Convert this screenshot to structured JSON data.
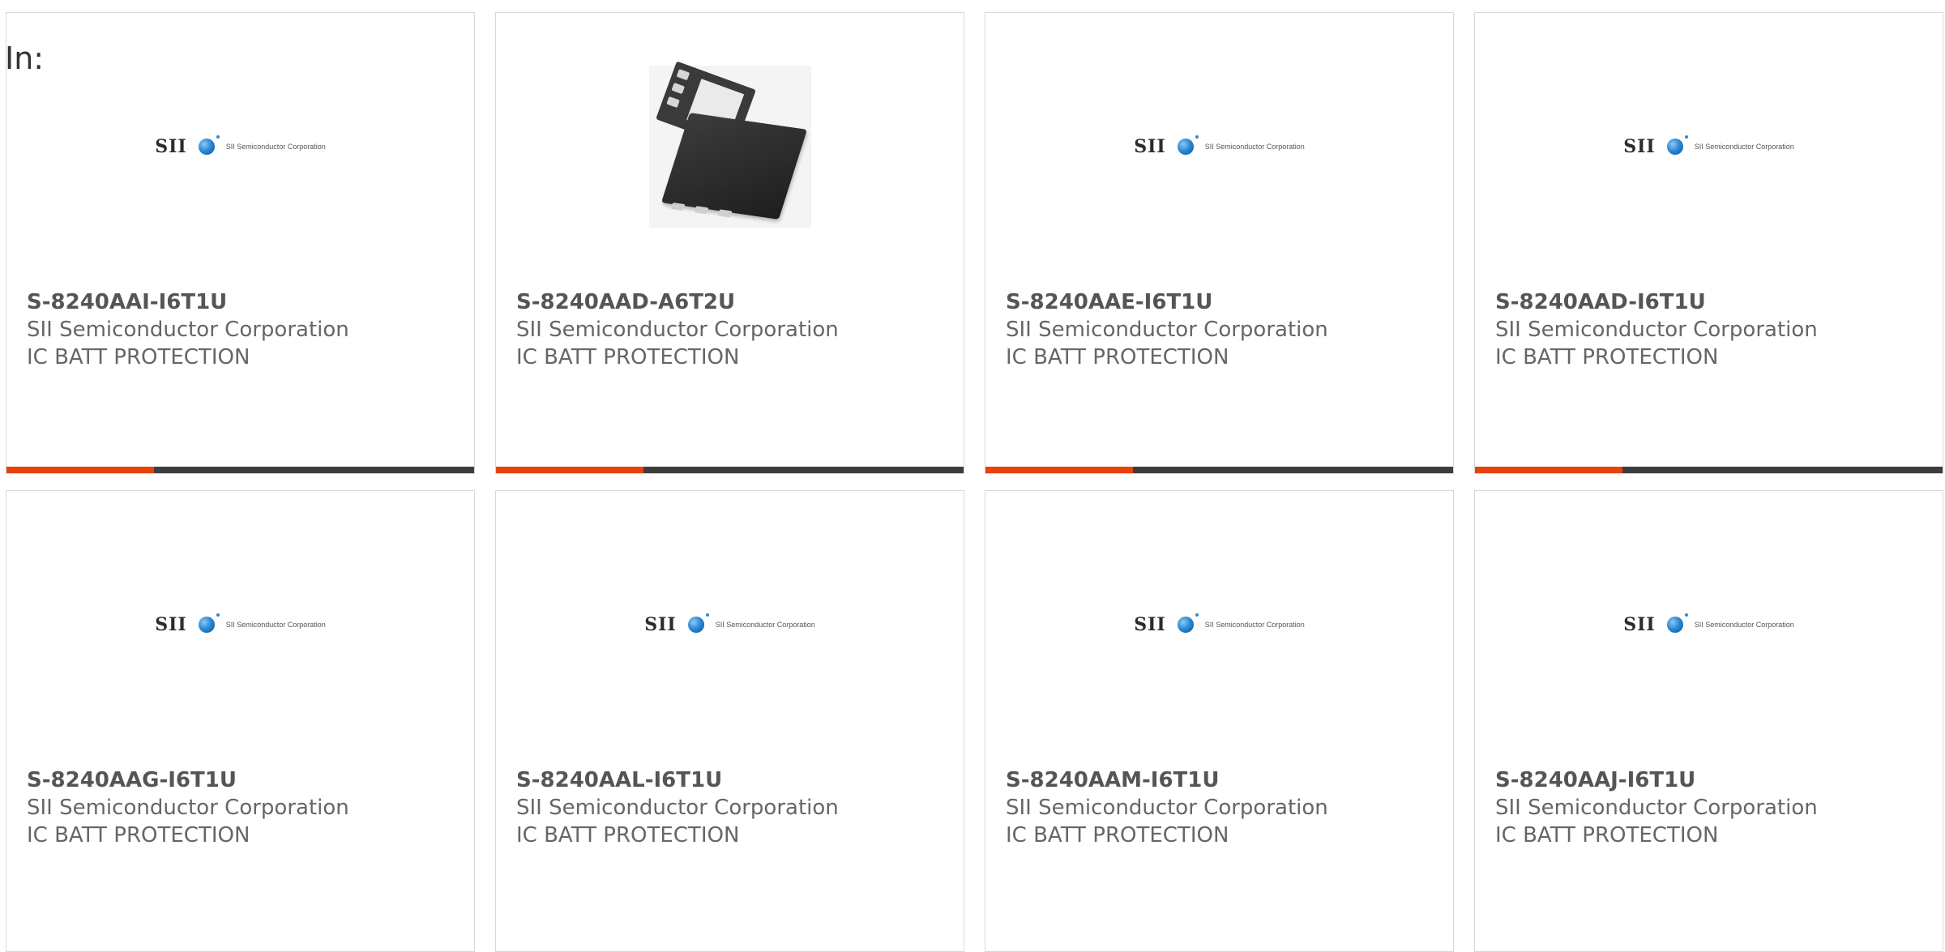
{
  "page_label": "In:",
  "accent_colors": {
    "orange": "#e8420c",
    "dark": "#3d3d3d"
  },
  "products": [
    {
      "part_number": "S-8240AAI-I6T1U",
      "manufacturer": "SII Semiconductor Corporation",
      "description": "IC BATT PROTECTION",
      "image": "sii-logo",
      "logo_mark": "SII",
      "logo_text": "SII Semiconductor Corporation"
    },
    {
      "part_number": "S-8240AAD-A6T2U",
      "manufacturer": "SII Semiconductor Corporation",
      "description": "IC BATT PROTECTION",
      "image": "chip-photo"
    },
    {
      "part_number": "S-8240AAE-I6T1U",
      "manufacturer": "SII Semiconductor Corporation",
      "description": "IC BATT PROTECTION",
      "image": "sii-logo",
      "logo_mark": "SII",
      "logo_text": "SII Semiconductor Corporation"
    },
    {
      "part_number": "S-8240AAD-I6T1U",
      "manufacturer": "SII Semiconductor Corporation",
      "description": "IC BATT PROTECTION",
      "image": "sii-logo",
      "logo_mark": "SII",
      "logo_text": "SII Semiconductor Corporation"
    },
    {
      "part_number": "S-8240AAG-I6T1U",
      "manufacturer": "SII Semiconductor Corporation",
      "description": "IC BATT PROTECTION",
      "image": "sii-logo",
      "logo_mark": "SII",
      "logo_text": "SII Semiconductor Corporation"
    },
    {
      "part_number": "S-8240AAL-I6T1U",
      "manufacturer": "SII Semiconductor Corporation",
      "description": "IC BATT PROTECTION",
      "image": "sii-logo",
      "logo_mark": "SII",
      "logo_text": "SII Semiconductor Corporation"
    },
    {
      "part_number": "S-8240AAM-I6T1U",
      "manufacturer": "SII Semiconductor Corporation",
      "description": "IC BATT PROTECTION",
      "image": "sii-logo",
      "logo_mark": "SII",
      "logo_text": "SII Semiconductor Corporation"
    },
    {
      "part_number": "S-8240AAJ-I6T1U",
      "manufacturer": "SII Semiconductor Corporation",
      "description": "IC BATT PROTECTION",
      "image": "sii-logo",
      "logo_mark": "SII",
      "logo_text": "SII Semiconductor Corporation"
    }
  ]
}
